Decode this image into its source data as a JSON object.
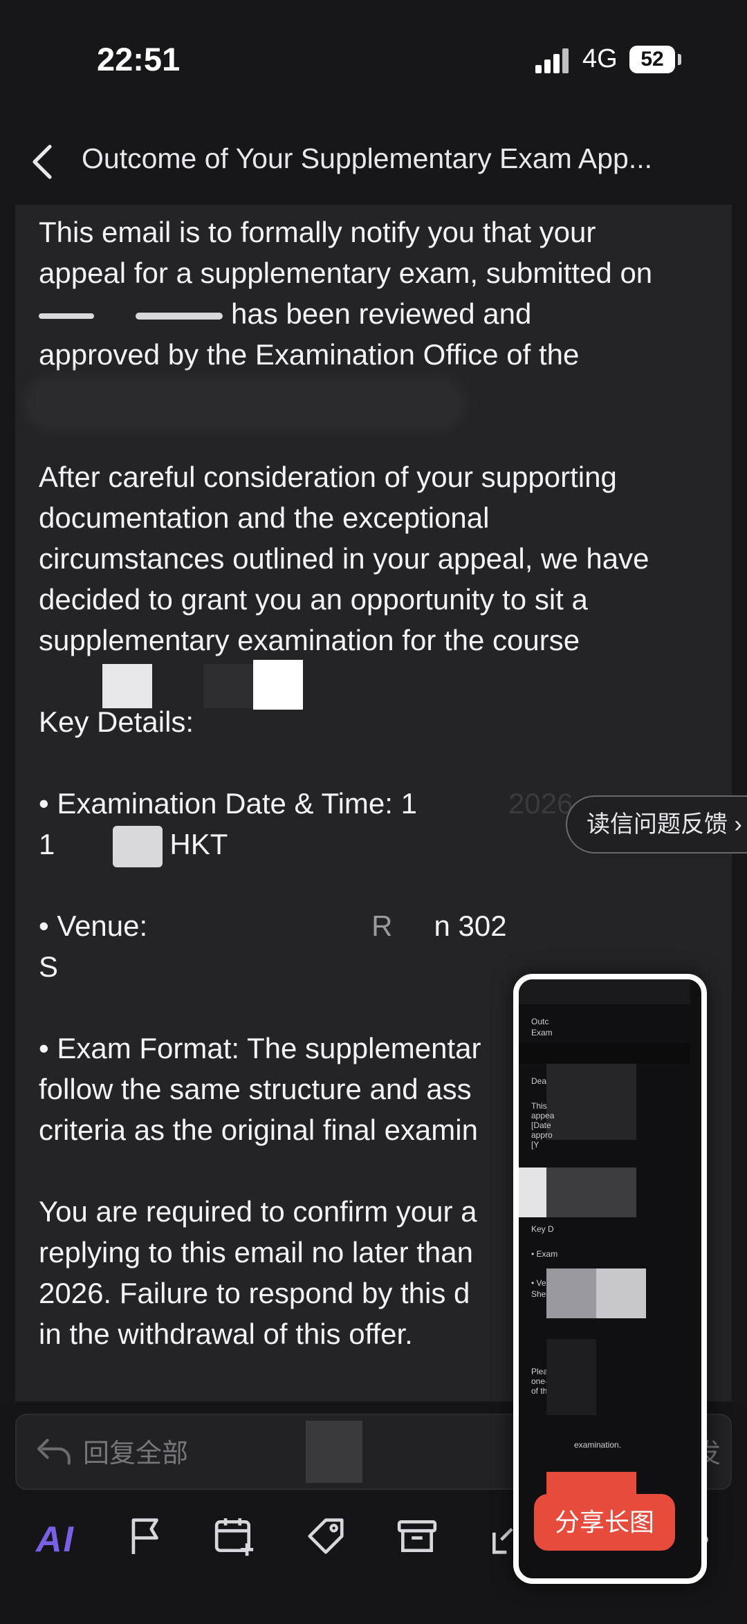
{
  "status_bar": {
    "time": "22:51",
    "network": "4G",
    "battery": "52"
  },
  "header": {
    "title": "Outcome of Your Supplementary Exam App..."
  },
  "email": {
    "p1_a": "This email is to formally notify you that your",
    "p1_b": "appeal for a supplementary exam, submitted on",
    "p1_c": "has been reviewed and",
    "p1_d": "approved by the Examination Office of the",
    "p2_a": "After careful consideration of your supporting",
    "p2_b": "documentation and the exceptional",
    "p2_c": "circumstances outlined in your appeal, we have",
    "p2_d": "decided to grant you an opportunity to sit a",
    "p2_e": "supplementary examination for the course",
    "key_details": "Key Details:",
    "date_label": "• Examination Date & Time: 1",
    "date_tail": "2026,",
    "time_head": "1",
    "time_tail": "HKT",
    "venue_label": "• Venue:",
    "venue_mid": "R",
    "venue_room": "n 302",
    "venue_line2": "S",
    "format_a": "• Exam Format: The supplementar",
    "format_b": "follow the same structure and ass",
    "format_c": "criteria as the original final examin",
    "confirm_a": "You are required to confirm your a",
    "confirm_b": "replying to this email no later than",
    "confirm_c": "2026. Failure to respond by this d",
    "confirm_d": "in the withdrawal of this offer."
  },
  "feedback_tab": "读信问题反馈 ›",
  "reply": {
    "placeholder": "回复全部",
    "send": "发"
  },
  "toolbar": {
    "ai_label": "AI"
  },
  "preview": {
    "share_label": "分享长图",
    "lines": [
      "Outc",
      "Exam",
      "Dear",
      "This",
      "appea",
      "[Date",
      "appro",
      "[Y",
      "Key D",
      "• Exam",
      "• Venu",
      "Shen",
      "Please",
      "one-tim",
      "of this",
      "examination."
    ]
  }
}
